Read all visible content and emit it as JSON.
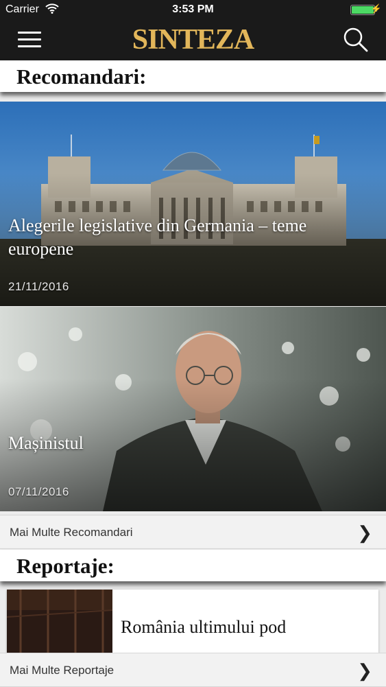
{
  "status_bar": {
    "carrier": "Carrier",
    "time": "3:53 PM",
    "battery_color": "#4cd964"
  },
  "navbar": {
    "logo": "SINTEZA",
    "logo_color": "#e2b65a",
    "menu_icon": "hamburger-icon",
    "search_icon": "search-icon"
  },
  "recommendations": {
    "title": "Recomandari:",
    "items": [
      {
        "headline": "Alegerile legislative din Germania – teme europene",
        "date": "21/11/2016"
      },
      {
        "headline": "Mașinistul",
        "date": "07/11/2016"
      }
    ],
    "more_label": "Mai Multe Recomandari"
  },
  "reports": {
    "title": "Reportaje:",
    "items": [
      {
        "title": "România ultimului pod"
      }
    ],
    "more_label": "Mai Multe Reportaje"
  },
  "chevron": "❯"
}
